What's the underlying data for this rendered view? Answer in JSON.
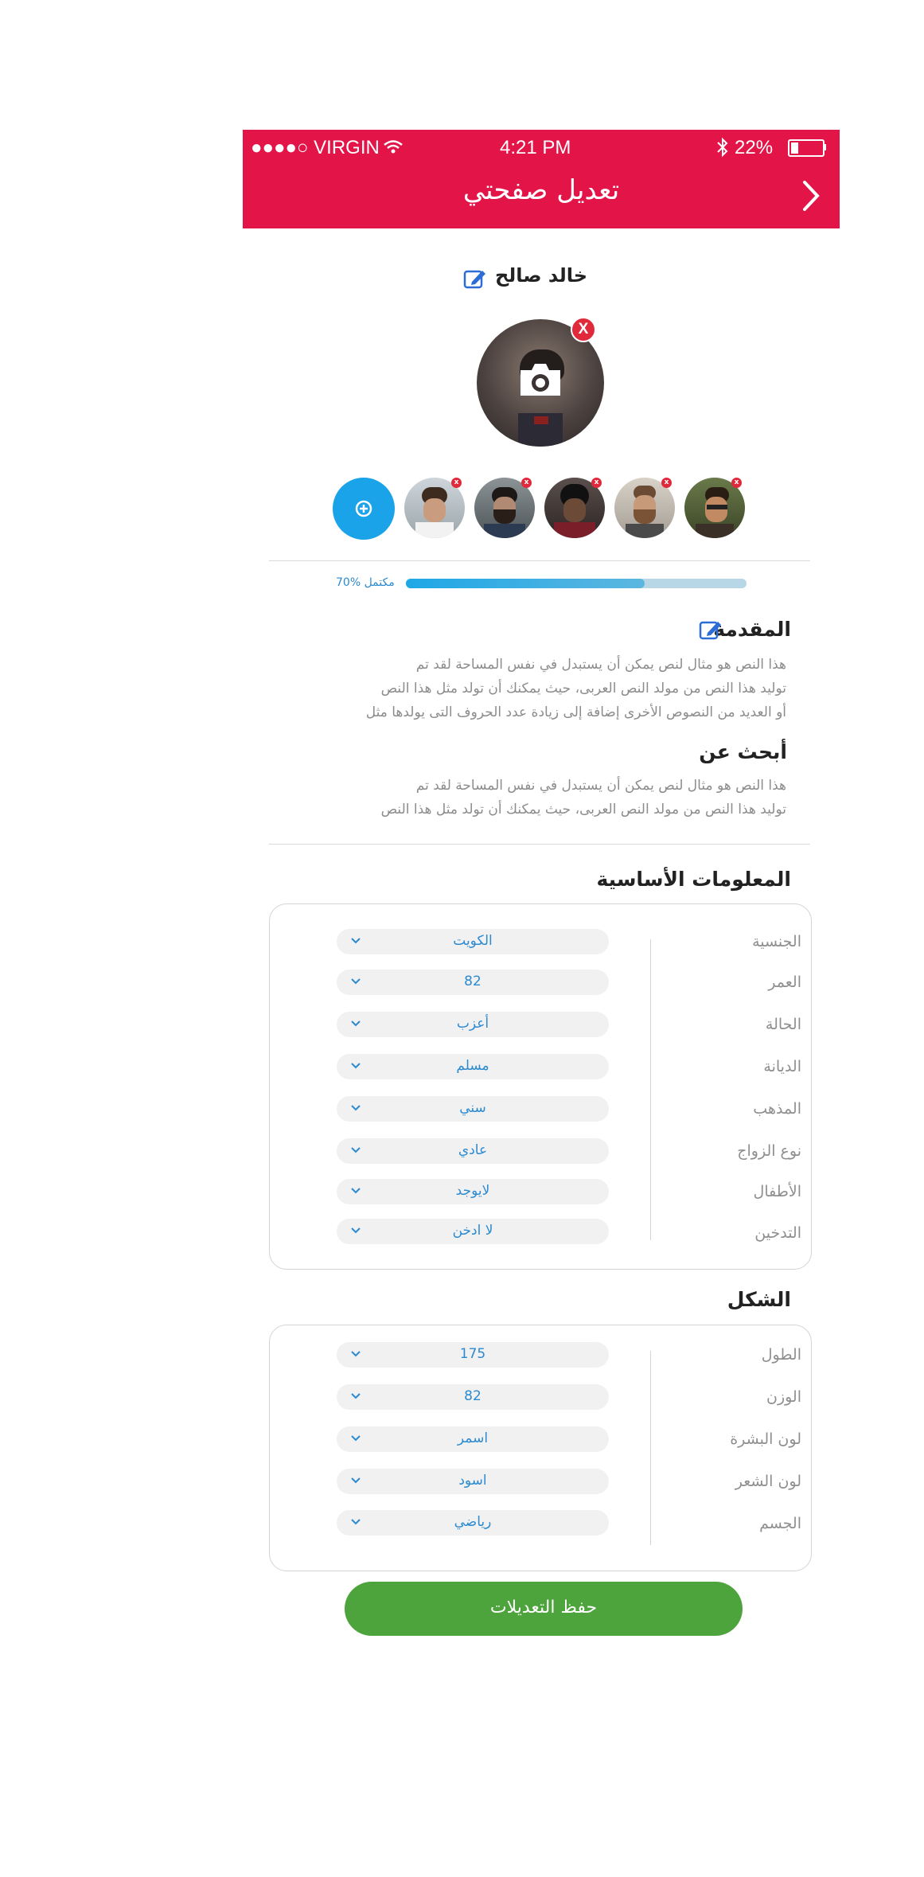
{
  "status_bar": {
    "carrier": "●●●●○ VIRGIN",
    "time": "4:21 PM",
    "battery": "22%"
  },
  "header": {
    "title": "تعديل صفحتي",
    "back_icon": "chevron-right-icon"
  },
  "profile": {
    "name": "خالد صالح",
    "edit_icon": "edit-icon",
    "camera_icon": "camera-icon",
    "remove_icon": "close-icon",
    "remove_label": "X"
  },
  "gallery": {
    "add_icon": "plus-icon",
    "remove_label": "x",
    "photo_count": 5
  },
  "progress": {
    "label": "70% مكتمل",
    "percent": 70
  },
  "intro": {
    "heading": "المقدمة",
    "lines": [
      "هذا النص هو مثال لنص يمكن أن يستبدل في نفس المساحة لقد تم",
      "توليد هذا النص من مولد النص العربى، حيث يمكنك أن تولد مثل هذا النص",
      "أو العديد من النصوص الأخرى إضافة إلى زيادة عدد الحروف التى يولدها مثل"
    ]
  },
  "looking_for": {
    "heading": "أبحث عن",
    "lines": [
      "هذا النص هو مثال لنص يمكن أن يستبدل في نفس المساحة لقد تم",
      "توليد هذا النص من مولد النص العربى، حيث يمكنك أن تولد مثل هذا النص"
    ]
  },
  "basic_info": {
    "heading": "المعلومات الأساسية",
    "rows": [
      {
        "label": "الجنسية",
        "value": "الكويت"
      },
      {
        "label": "العمر",
        "value": "82"
      },
      {
        "label": "الحالة",
        "value": "أعزب"
      },
      {
        "label": "الديانة",
        "value": "مسلم"
      },
      {
        "label": "المذهب",
        "value": "سني"
      },
      {
        "label": "نوع الزواج",
        "value": "عادي"
      },
      {
        "label": "الأطفال",
        "value": "لايوجد"
      },
      {
        "label": "التدخين",
        "value": "لا ادخن"
      }
    ]
  },
  "appearance": {
    "heading": "الشكل",
    "rows": [
      {
        "label": "الطول",
        "value": "175"
      },
      {
        "label": "الوزن",
        "value": "82"
      },
      {
        "label": "لون البشرة",
        "value": "اسمر"
      },
      {
        "label": "لون الشعر",
        "value": "اسود"
      },
      {
        "label": "الجسم",
        "value": "رياضي"
      }
    ]
  },
  "save_button": {
    "label": "حفظ التعديلات"
  },
  "colors": {
    "brand": "#e31548",
    "accent": "#2b8ad0",
    "save": "#4da33c",
    "add": "#1aa3e8"
  }
}
